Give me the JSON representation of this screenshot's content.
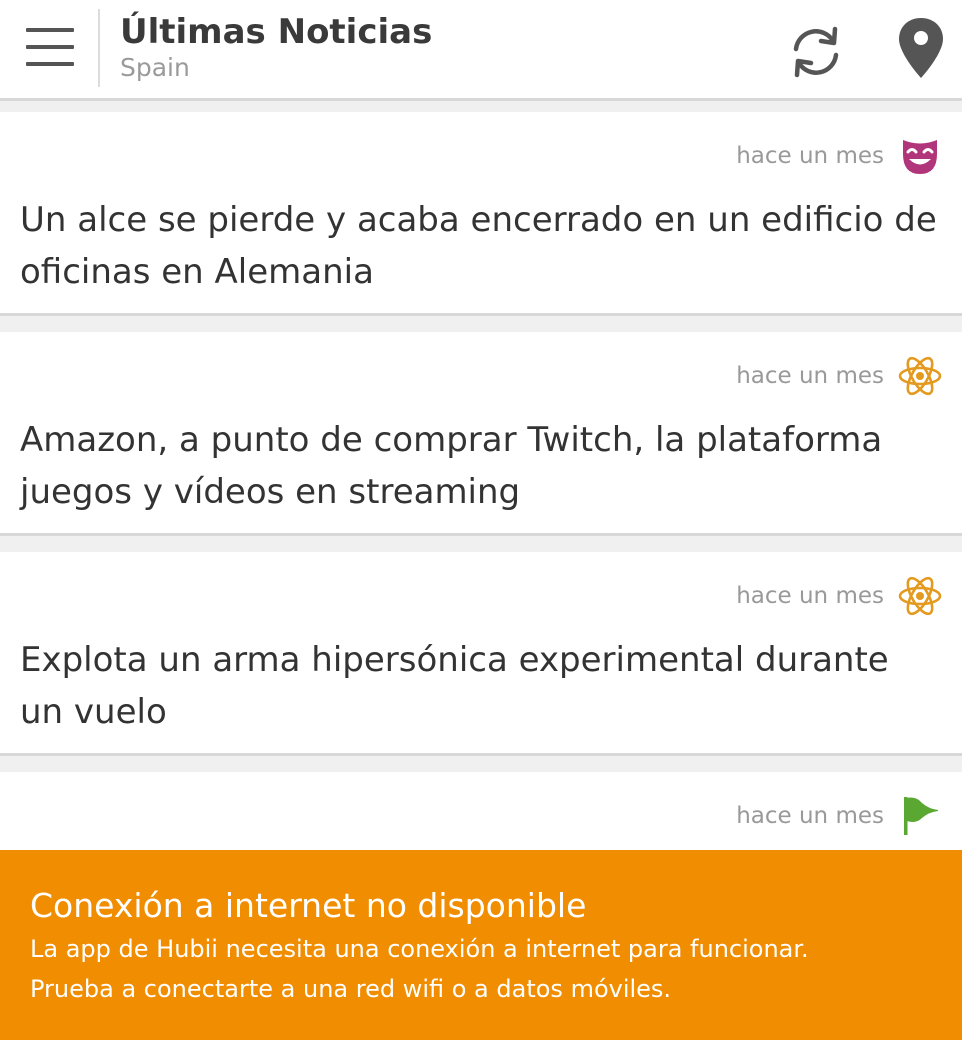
{
  "header": {
    "title": "Últimas Noticias",
    "subtitle": "Spain",
    "menu_icon": "hamburger-menu-icon",
    "refresh_icon": "refresh-icon",
    "location_icon": "location-pin-icon"
  },
  "news": [
    {
      "time": "hace un mes",
      "category_icon": "comedy-mask-icon",
      "icon_color": "#b0357a",
      "title": "Un alce se pierde y acaba encerrado en un edificio de oficinas en Alemania"
    },
    {
      "time": "hace un mes",
      "category_icon": "atom-science-icon",
      "icon_color": "#e39a1e",
      "title": "Amazon, a punto de comprar Twitch, la plataforma juegos y vídeos en streaming"
    },
    {
      "time": "hace un mes",
      "category_icon": "atom-science-icon",
      "icon_color": "#e39a1e",
      "title": "Explota un arma hipersónica experimental durante un vuelo"
    },
    {
      "time": "hace un mes",
      "category_icon": "flag-icon",
      "icon_color": "#5aa832",
      "title": ""
    }
  ],
  "offline_banner": {
    "title": "Conexión a internet no disponible",
    "line1": "La app de Hubii necesita una conexión a internet para funcionar.",
    "line2": "Prueba a conectarte a una red wifi o a datos móviles.",
    "background": "#f08d00"
  }
}
